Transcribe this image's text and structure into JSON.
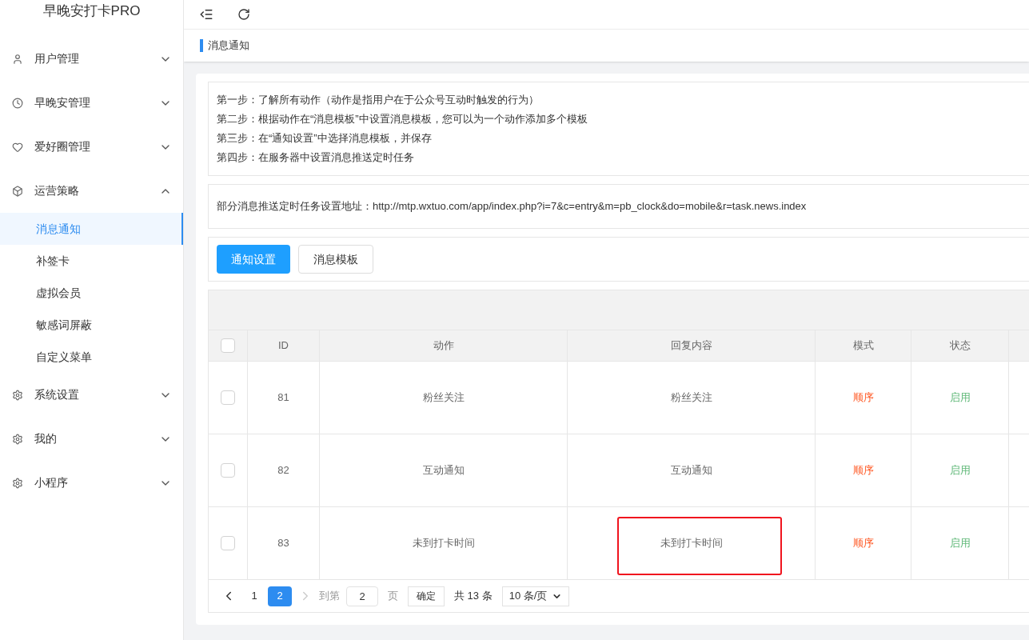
{
  "app_title": "早晚安打卡PRO",
  "sidebar": {
    "items": [
      {
        "label": "用户管理",
        "expanded": false
      },
      {
        "label": "早晚安管理",
        "expanded": false
      },
      {
        "label": "爱好圈管理",
        "expanded": false
      },
      {
        "label": "运营策略",
        "expanded": true,
        "children": [
          {
            "label": "消息通知",
            "selected": true
          },
          {
            "label": "补签卡",
            "selected": false
          },
          {
            "label": "虚拟会员",
            "selected": false
          },
          {
            "label": "敏感词屏蔽",
            "selected": false
          },
          {
            "label": "自定义菜单",
            "selected": false
          }
        ]
      },
      {
        "label": "系统设置",
        "expanded": false
      },
      {
        "label": "我的",
        "expanded": false
      },
      {
        "label": "小程序",
        "expanded": false
      }
    ]
  },
  "breadcrumb_tab": "消息通知",
  "steps": [
    "第一步：了解所有动作（动作是指用户在于公众号互动时触发的行为）",
    "第二步：根据动作在“消息模板”中设置消息模板，您可以为一个动作添加多个模板",
    "第三步：在“通知设置”中选择消息模板，并保存",
    "第四步：在服务器中设置消息推送定时任务"
  ],
  "address_note": "部分消息推送定时任务设置地址：http://mtp.wxtuo.com/app/index.php?i=7&c=entry&m=pb_clock&do=mobile&r=task.news.index",
  "buttons": [
    {
      "label": "通知设置",
      "selected": true
    },
    {
      "label": "消息模板",
      "selected": false
    }
  ],
  "table": {
    "select_all_checked": false,
    "columns": [
      "ID",
      "动作",
      "回复内容",
      "模式",
      "状态"
    ],
    "rows": [
      {
        "checked": false,
        "id": "81",
        "action": "粉丝关注",
        "reply": "粉丝关注",
        "mode": "顺序",
        "status": "启用",
        "highlighted": false
      },
      {
        "checked": false,
        "id": "82",
        "action": "互动通知",
        "reply": "互动通知",
        "mode": "顺序",
        "status": "启用",
        "highlighted": false
      },
      {
        "checked": false,
        "id": "83",
        "action": "未到打卡时间",
        "reply": "未到打卡时间",
        "mode": "顺序",
        "status": "启用",
        "highlighted": true
      }
    ]
  },
  "pagination": {
    "pages": [
      {
        "label": "1",
        "selected": false
      },
      {
        "label": "2",
        "selected": true
      }
    ],
    "next_disabled": true,
    "goto_label": "到第",
    "goto_value": "2",
    "page_unit": "页",
    "confirm": "确定",
    "total": "共 13 条",
    "page_size": "10 条/页"
  }
}
